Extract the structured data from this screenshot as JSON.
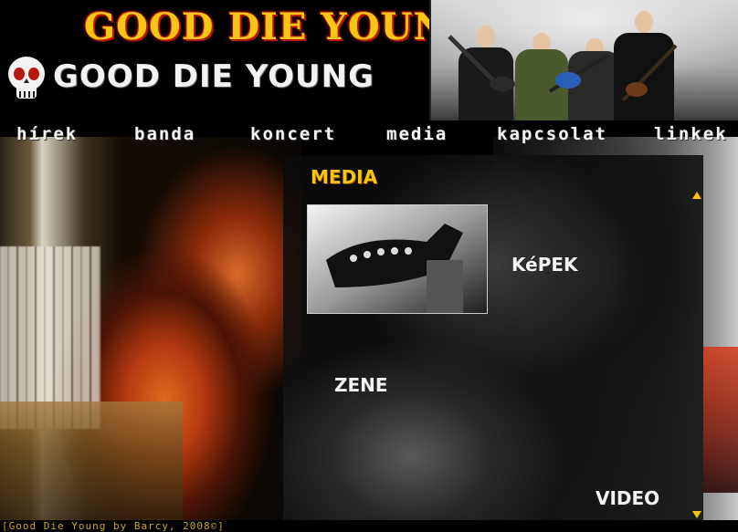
{
  "header": {
    "big_title": "GOOD DIE YOUNG",
    "small_title": "GOOD DIE YOUNG"
  },
  "nav": {
    "items": [
      {
        "label": "hírek"
      },
      {
        "label": "banda"
      },
      {
        "label": "koncert"
      },
      {
        "label": "media"
      },
      {
        "label": "kapcsolat"
      },
      {
        "label": "linkek"
      }
    ]
  },
  "content": {
    "section_title": "MEDIA",
    "links": {
      "kepek": "KéPEK",
      "zene": "ZENE",
      "video": "VIDEO"
    }
  },
  "footer": {
    "text": "[Good Die Young by Barcy, 2008©]"
  },
  "colors": {
    "accent_yellow": "#f6c514",
    "accent_red": "#b8160e",
    "background": "#000000"
  },
  "icons": {
    "logo": "skull-icon",
    "scroll_up": "scroll-up-icon",
    "scroll_down": "scroll-down-icon"
  }
}
